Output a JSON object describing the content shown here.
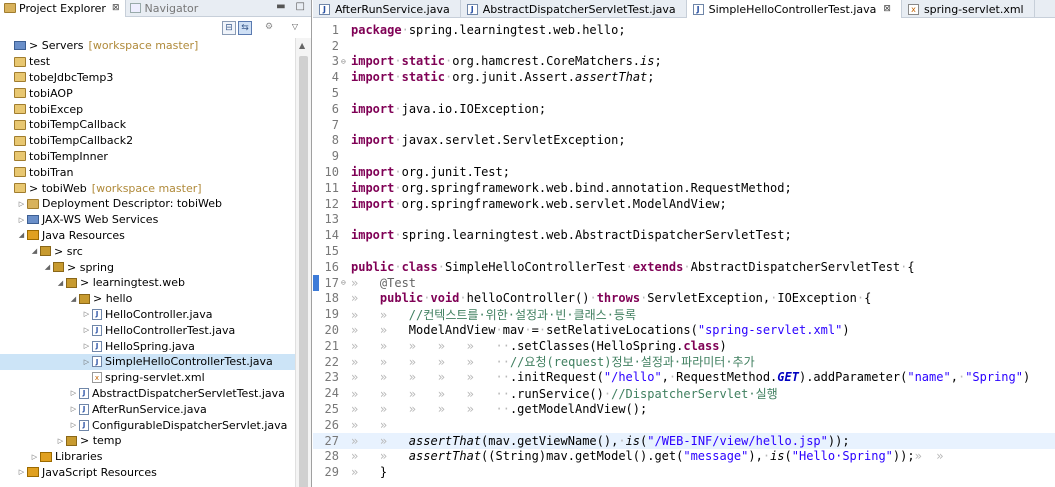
{
  "explorer": {
    "tab_active": "Project Explorer",
    "tab_other": "Navigator",
    "tree": [
      {
        "d": 0,
        "tw": "",
        "ic": "srv",
        "t": "> Servers",
        "x": "[workspace master]"
      },
      {
        "d": 0,
        "tw": "",
        "ic": "proj",
        "t": "test"
      },
      {
        "d": 0,
        "tw": "",
        "ic": "proj",
        "t": "tobeJdbcTemp3"
      },
      {
        "d": 0,
        "tw": "",
        "ic": "proj",
        "t": "tobiAOP"
      },
      {
        "d": 0,
        "tw": "",
        "ic": "proj",
        "t": "tobiExcep"
      },
      {
        "d": 0,
        "tw": "",
        "ic": "proj",
        "t": "tobiTempCallback"
      },
      {
        "d": 0,
        "tw": "",
        "ic": "proj",
        "t": "tobiTempCallback2"
      },
      {
        "d": 0,
        "tw": "",
        "ic": "proj",
        "t": "tobiTempInner"
      },
      {
        "d": 0,
        "tw": "",
        "ic": "proj",
        "t": "tobiTran"
      },
      {
        "d": 0,
        "tw": "",
        "ic": "proj",
        "t": "> tobiWeb",
        "x": "[workspace master]"
      },
      {
        "d": 1,
        "tw": "▷",
        "ic": "folder",
        "t": "Deployment Descriptor: tobiWeb"
      },
      {
        "d": 1,
        "tw": "▷",
        "ic": "srv",
        "t": "JAX-WS Web Services"
      },
      {
        "d": 1,
        "tw": "◢",
        "ic": "jar",
        "t": "Java Resources"
      },
      {
        "d": 2,
        "tw": "◢",
        "ic": "pkg",
        "t": "> src"
      },
      {
        "d": 3,
        "tw": "◢",
        "ic": "pkg",
        "t": "> spring"
      },
      {
        "d": 4,
        "tw": "◢",
        "ic": "pkg",
        "t": "> learningtest.web"
      },
      {
        "d": 5,
        "tw": "◢",
        "ic": "pkg",
        "t": "> hello"
      },
      {
        "d": 6,
        "tw": "▷",
        "ic": "java",
        "t": "HelloController.java"
      },
      {
        "d": 6,
        "tw": "▷",
        "ic": "java",
        "t": "HelloControllerTest.java"
      },
      {
        "d": 6,
        "tw": "▷",
        "ic": "java",
        "t": "HelloSpring.java"
      },
      {
        "d": 6,
        "tw": "▷",
        "ic": "java",
        "t": "SimpleHelloControllerTest.java",
        "sel": true
      },
      {
        "d": 6,
        "tw": "",
        "ic": "xml",
        "t": "spring-servlet.xml"
      },
      {
        "d": 5,
        "tw": "▷",
        "ic": "java",
        "t": "AbstractDispatcherServletTest.java"
      },
      {
        "d": 5,
        "tw": "▷",
        "ic": "java",
        "t": "AfterRunService.java"
      },
      {
        "d": 5,
        "tw": "▷",
        "ic": "java",
        "t": "ConfigurableDispatcherServlet.java"
      },
      {
        "d": 4,
        "tw": "▷",
        "ic": "pkg",
        "t": "> temp"
      },
      {
        "d": 2,
        "tw": "▷",
        "ic": "jar",
        "t": "Libraries"
      },
      {
        "d": 1,
        "tw": "▷",
        "ic": "jar",
        "t": "JavaScript Resources"
      }
    ]
  },
  "editor": {
    "tabs": [
      {
        "label": "AfterRunService.java",
        "icon": "java"
      },
      {
        "label": "AbstractDispatcherServletTest.java",
        "icon": "java"
      },
      {
        "label": "SimpleHelloControllerTest.java",
        "icon": "java",
        "active": true
      },
      {
        "label": "spring-servlet.xml",
        "icon": "xml"
      }
    ],
    "lines": [
      {
        "n": "1",
        "s": [
          [
            "kw",
            "package"
          ],
          [
            "ws",
            "·"
          ],
          [
            "",
            "spring.learningtest.web.hello;"
          ]
        ]
      },
      {
        "n": "2",
        "s": []
      },
      {
        "n": "3",
        "f": "⊖",
        "s": [
          [
            "kw",
            "import"
          ],
          [
            "ws",
            "·"
          ],
          [
            "kw",
            "static"
          ],
          [
            "ws",
            "·"
          ],
          [
            "",
            "org.hamcrest.CoreMatchers."
          ],
          [
            "it",
            "is"
          ],
          [
            "",
            "; "
          ]
        ]
      },
      {
        "n": "4",
        "s": [
          [
            "kw",
            "import"
          ],
          [
            "ws",
            "·"
          ],
          [
            "kw",
            "static"
          ],
          [
            "ws",
            "·"
          ],
          [
            "",
            "org.junit.Assert."
          ],
          [
            "it",
            "assertThat"
          ],
          [
            "",
            ";"
          ]
        ]
      },
      {
        "n": "5",
        "s": []
      },
      {
        "n": "6",
        "s": [
          [
            "kw",
            "import"
          ],
          [
            "ws",
            "·"
          ],
          [
            "",
            "java.io.IOException;"
          ]
        ]
      },
      {
        "n": "7",
        "s": []
      },
      {
        "n": "8",
        "s": [
          [
            "kw",
            "import"
          ],
          [
            "ws",
            "·"
          ],
          [
            "",
            "javax.servlet.ServletException;"
          ]
        ]
      },
      {
        "n": "9",
        "s": []
      },
      {
        "n": "10",
        "s": [
          [
            "kw",
            "import"
          ],
          [
            "ws",
            "·"
          ],
          [
            "",
            "org.junit.Test;"
          ]
        ]
      },
      {
        "n": "11",
        "s": [
          [
            "kw",
            "import"
          ],
          [
            "ws",
            "·"
          ],
          [
            "",
            "org.springframework.web.bind.annotation.RequestMethod;"
          ]
        ]
      },
      {
        "n": "12",
        "s": [
          [
            "kw",
            "import"
          ],
          [
            "ws",
            "·"
          ],
          [
            "",
            "org.springframework.web.servlet.ModelAndView;"
          ]
        ]
      },
      {
        "n": "13",
        "s": []
      },
      {
        "n": "14",
        "s": [
          [
            "kw",
            "import"
          ],
          [
            "ws",
            "·"
          ],
          [
            "",
            "spring.learningtest.web.AbstractDispatcherServletTest;"
          ]
        ]
      },
      {
        "n": "15",
        "s": []
      },
      {
        "n": "16",
        "s": [
          [
            "kw",
            "public"
          ],
          [
            "ws",
            "·"
          ],
          [
            "kw",
            "class"
          ],
          [
            "ws",
            "·"
          ],
          [
            "",
            "SimpleHelloControllerTest"
          ],
          [
            "ws",
            "·"
          ],
          [
            "kw",
            "extends"
          ],
          [
            "ws",
            "·"
          ],
          [
            "",
            "AbstractDispatcherServletTest"
          ],
          [
            "ws",
            "·"
          ],
          [
            "",
            "{"
          ]
        ]
      },
      {
        "n": "17",
        "f": "⊖",
        "mk": true,
        "s": [
          [
            "ws",
            "»   "
          ],
          [
            "ann",
            "@Test"
          ]
        ]
      },
      {
        "n": "18",
        "s": [
          [
            "ws",
            "»   "
          ],
          [
            "kw",
            "public"
          ],
          [
            "ws",
            "·"
          ],
          [
            "kw",
            "void"
          ],
          [
            "ws",
            "·"
          ],
          [
            "",
            "helloController()"
          ],
          [
            "ws",
            "·"
          ],
          [
            "kw",
            "throws"
          ],
          [
            "ws",
            "·"
          ],
          [
            "",
            "ServletException,"
          ],
          [
            "ws",
            "·"
          ],
          [
            "",
            "IOException"
          ],
          [
            "ws",
            "·"
          ],
          [
            "",
            "{"
          ]
        ]
      },
      {
        "n": "19",
        "s": [
          [
            "ws",
            "»   »   "
          ],
          [
            "cmt",
            "//컨텍스트를·위한·설정과·빈·클래스·등록"
          ]
        ]
      },
      {
        "n": "20",
        "s": [
          [
            "ws",
            "»   »   "
          ],
          [
            "",
            "ModelAndView"
          ],
          [
            "ws",
            "·"
          ],
          [
            "",
            "mav"
          ],
          [
            "ws",
            "·"
          ],
          [
            "",
            "="
          ],
          [
            "ws",
            "·"
          ],
          [
            "",
            "setRelativeLocations("
          ],
          [
            "str",
            "\"spring-servlet.xml\""
          ],
          [
            "",
            ")"
          ]
        ]
      },
      {
        "n": "21",
        "s": [
          [
            "ws",
            "»   »   »   »   »   ··"
          ],
          [
            "",
            ".setClasses(HelloSpring."
          ],
          [
            "kw",
            "class"
          ],
          [
            "",
            ")"
          ]
        ]
      },
      {
        "n": "22",
        "s": [
          [
            "ws",
            "»   »   »   »   »   ··"
          ],
          [
            "cmt",
            "//요청(request)정보·설정과·파라미터·추가"
          ]
        ]
      },
      {
        "n": "23",
        "s": [
          [
            "ws",
            "»   »   »   »   »   ··"
          ],
          [
            "",
            ".initRequest("
          ],
          [
            "str",
            "\"/hello\""
          ],
          [
            "",
            ","
          ],
          [
            "ws",
            "·"
          ],
          [
            "",
            "RequestMethod."
          ],
          [
            "ib",
            "GET"
          ],
          [
            "",
            ").addParameter("
          ],
          [
            "str",
            "\"name\""
          ],
          [
            "",
            ","
          ],
          [
            "ws",
            "·"
          ],
          [
            "str",
            "\"Spring\""
          ],
          [
            "",
            ")"
          ]
        ]
      },
      {
        "n": "24",
        "s": [
          [
            "ws",
            "»   »   »   »   »   ··"
          ],
          [
            "",
            ".runService()"
          ],
          [
            "ws",
            "·"
          ],
          [
            "cmt",
            "//DispatcherServlet·실행"
          ]
        ]
      },
      {
        "n": "25",
        "s": [
          [
            "ws",
            "»   »   »   »   »   ··"
          ],
          [
            "",
            ".getModelAndView();"
          ]
        ]
      },
      {
        "n": "26",
        "s": [
          [
            "ws",
            "»   »   "
          ]
        ]
      },
      {
        "n": "27",
        "hl": true,
        "s": [
          [
            "ws",
            "»   »   "
          ],
          [
            "it",
            "assertThat"
          ],
          [
            "",
            "(mav.getViewName(),"
          ],
          [
            "ws",
            "·"
          ],
          [
            "it",
            "is"
          ],
          [
            "",
            "("
          ],
          [
            "str",
            "\"/WEB-INF/view/hello.jsp\""
          ],
          [
            "",
            "));"
          ]
        ]
      },
      {
        "n": "28",
        "s": [
          [
            "ws",
            "»   »   "
          ],
          [
            "it",
            "assertThat"
          ],
          [
            "",
            "((String)mav.getModel().get("
          ],
          [
            "str",
            "\"message\""
          ],
          [
            "",
            "),"
          ],
          [
            "ws",
            "·"
          ],
          [
            "it",
            "is"
          ],
          [
            "",
            "("
          ],
          [
            "str",
            "\"Hello·Spring\""
          ],
          [
            "",
            "));"
          ],
          [
            "ws",
            "»  »"
          ]
        ]
      },
      {
        "n": "29",
        "s": [
          [
            "ws",
            "»   "
          ],
          [
            "",
            "}"
          ]
        ]
      }
    ]
  }
}
